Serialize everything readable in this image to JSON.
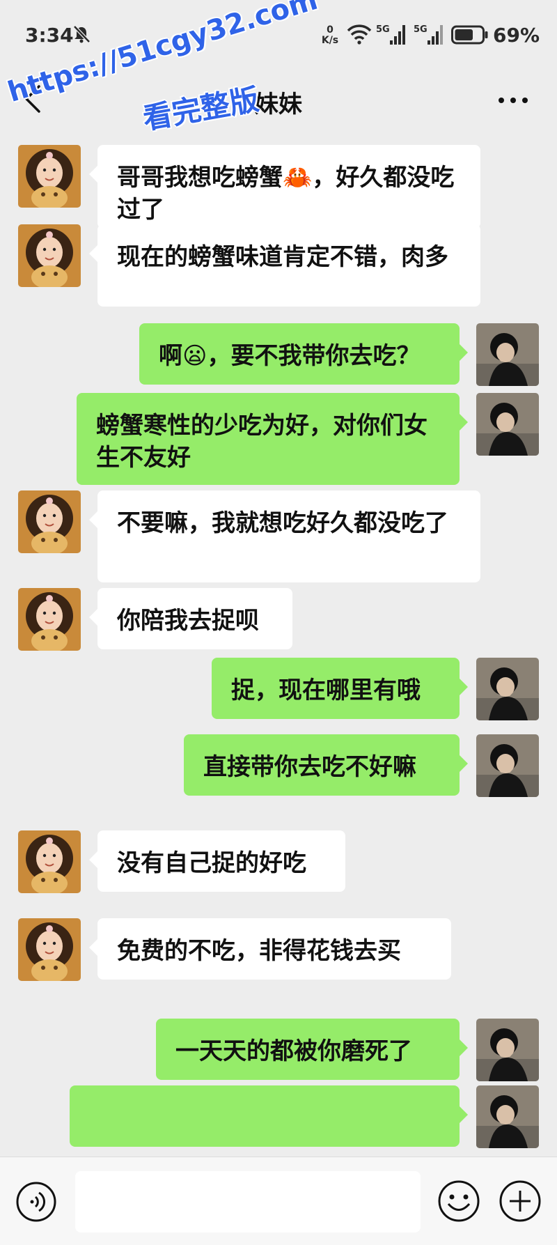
{
  "status_bar": {
    "time": "3:34",
    "net_speed_value": "0",
    "net_speed_unit": "K/s",
    "signal_1_label": "5G",
    "signal_2_label": "5G",
    "battery_percent": "69%",
    "battery_level": 0.69
  },
  "header": {
    "title": "妹妹",
    "back_icon": "chevron-left-icon",
    "more_icon": "more-dots-icon"
  },
  "watermark": {
    "line_1": "https://51cgy32.com",
    "line_2": "看完整版"
  },
  "messages": [
    {
      "side": "left",
      "text": "哥哥我想吃螃蟹🦀，好久都没吃过了"
    },
    {
      "side": "left",
      "text": "现在的螃蟹味道肯定不错，肉多"
    },
    {
      "side": "right",
      "text": "啊😦，要不我带你去吃？"
    },
    {
      "side": "right",
      "text": "螃蟹寒性的少吃为好，对你们女生不友好"
    },
    {
      "side": "left",
      "text": "不要嘛，我就想吃好久都没吃了"
    },
    {
      "side": "left",
      "text": "你陪我去捉呗"
    },
    {
      "side": "right",
      "text": "捉，现在哪里有哦"
    },
    {
      "side": "right",
      "text": "直接带你去吃不好嘛"
    },
    {
      "side": "left",
      "text": "没有自己捉的好吃"
    },
    {
      "side": "left",
      "text": "免费的不吃，非得花钱去买"
    },
    {
      "side": "right",
      "text": "一天天的都被你磨死了"
    },
    {
      "side": "right",
      "text": ""
    }
  ],
  "input_bar": {
    "placeholder": "",
    "voice_icon": "voice-icon",
    "emoji_icon": "emoji-icon",
    "plus_icon": "plus-icon"
  },
  "colors": {
    "background": "#ededed",
    "bubble_left": "#ffffff",
    "bubble_right": "#95ec69",
    "watermark": "#2f63e8"
  }
}
